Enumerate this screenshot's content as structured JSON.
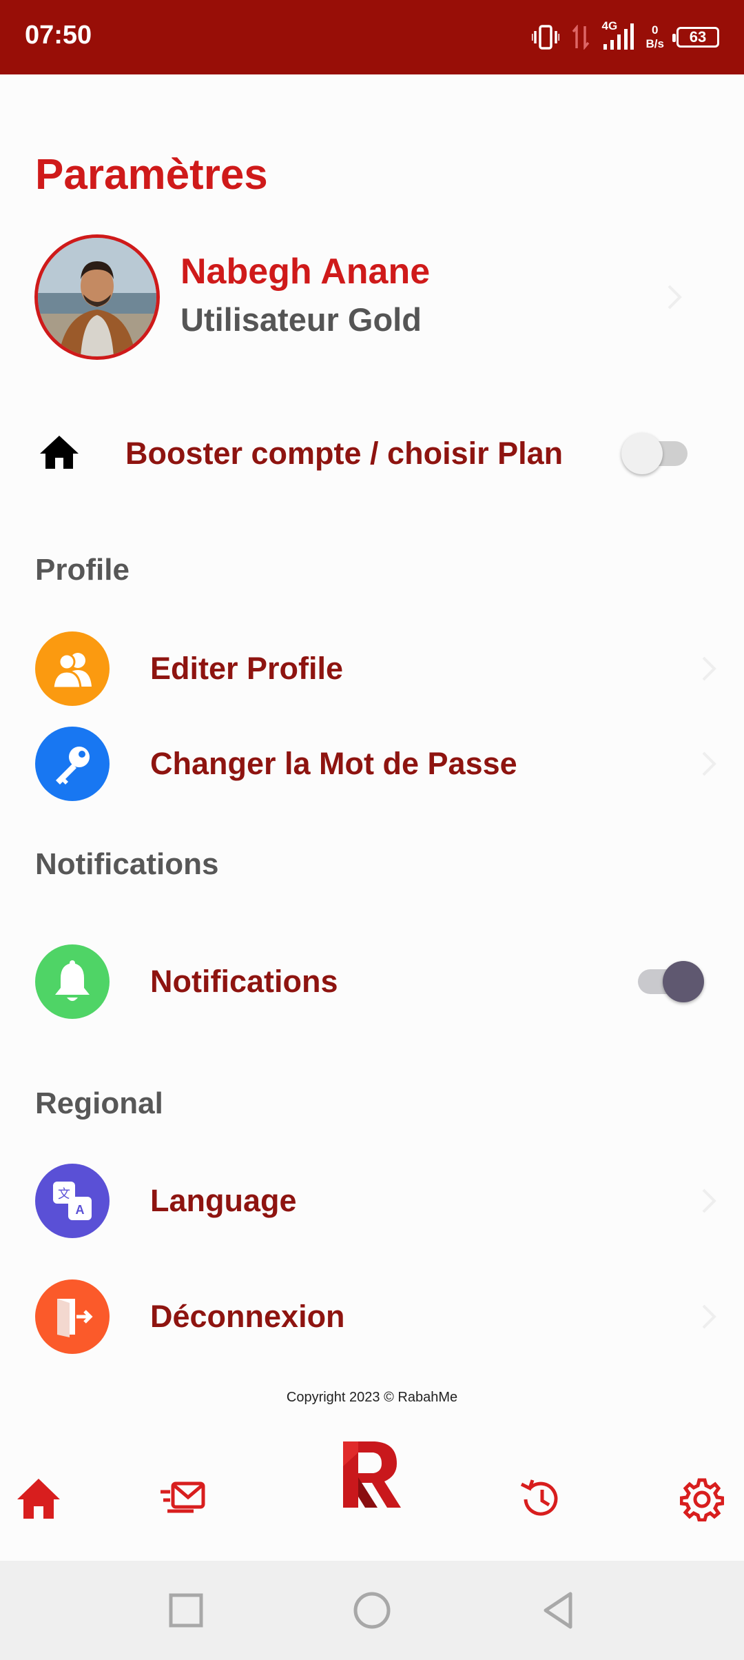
{
  "status_bar": {
    "time": "07:50",
    "network_type": "4G",
    "speed_value": "0",
    "speed_unit": "B/s",
    "battery": "63"
  },
  "page": {
    "title": "Paramètres"
  },
  "profile": {
    "name": "Nabegh Anane",
    "role": "Utilisateur Gold"
  },
  "boost": {
    "label": "Booster compte / choisir Plan",
    "toggle_on": false
  },
  "sections": {
    "profile": {
      "title": "Profile",
      "items": [
        {
          "label": "Editer Profile",
          "icon": "users-icon",
          "color": "#fb9a10"
        },
        {
          "label": "Changer la Mot de Passe",
          "icon": "key-icon",
          "color": "#1877f2"
        }
      ]
    },
    "notifications": {
      "title": "Notifications",
      "items": [
        {
          "label": "Notifications",
          "icon": "bell-icon",
          "color": "#4fd466",
          "toggle_on": true
        }
      ]
    },
    "regional": {
      "title": "Regional",
      "items": [
        {
          "label": "Language",
          "icon": "translate-icon",
          "color": "#5a50d6"
        },
        {
          "label": "Déconnexion",
          "icon": "logout-door-icon",
          "color": "#fb5a2a"
        }
      ]
    }
  },
  "footer": {
    "copyright": "Copyright 2023 © RabahMe"
  },
  "bottom_nav": {
    "items": [
      {
        "name": "home",
        "icon": "home-icon"
      },
      {
        "name": "messages",
        "icon": "mail-fast-icon"
      },
      {
        "name": "brand",
        "icon": "rabahme-logo"
      },
      {
        "name": "history",
        "icon": "history-icon"
      },
      {
        "name": "settings",
        "icon": "gear-icon"
      }
    ],
    "accent": "#d81e1e"
  },
  "colors": {
    "status_bar": "#980e07",
    "title_red": "#cf1a1a",
    "label_red": "#8e1410",
    "section_gray": "#575757",
    "toggle_knob_on": "#5f5870"
  }
}
